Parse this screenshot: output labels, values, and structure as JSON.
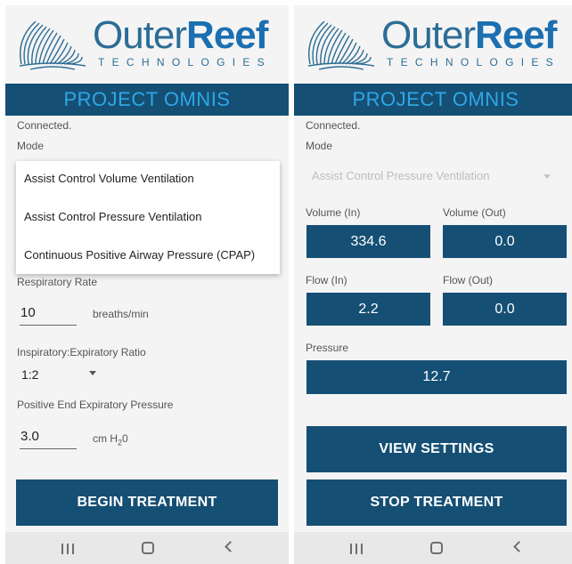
{
  "brand": {
    "outer": "Outer",
    "reef": "Reef",
    "sub": "TECHNOLOGIES"
  },
  "title": "PROJECT OMNIS",
  "colors": {
    "primary_dark": "#154f74",
    "title_text": "#2fa7e6",
    "logo_blue": "#2c6d96"
  },
  "left": {
    "status": "Connected.",
    "mode_label": "Mode",
    "mode_options": [
      "Assist Control Volume Ventilation",
      "Assist Control Pressure Ventilation",
      "Continuous Positive Airway Pressure (CPAP)"
    ],
    "respiratory_rate_label": "Respiratory Rate",
    "respiratory_rate_value": "10",
    "respiratory_rate_unit": "breaths/min",
    "ie_ratio_label": "Inspiratory:Expiratory Ratio",
    "ie_ratio_value": "1:2",
    "peep_label": "Positive End Expiratory Pressure",
    "peep_value": "3.0",
    "peep_unit_prefix": "cm H",
    "peep_unit_sub": "2",
    "peep_unit_suffix": "0",
    "begin_button": "BEGIN TREATMENT"
  },
  "right": {
    "status": "Connected.",
    "mode_label": "Mode",
    "mode_value": "Assist Control Pressure Ventilation",
    "volume_in_label": "Volume (In)",
    "volume_in_value": "334.6",
    "volume_out_label": "Volume (Out)",
    "volume_out_value": "0.0",
    "flow_in_label": "Flow (In)",
    "flow_in_value": "2.2",
    "flow_out_label": "Flow (Out)",
    "flow_out_value": "0.0",
    "pressure_label": "Pressure",
    "pressure_value": "12.7",
    "view_settings_button": "VIEW SETTINGS",
    "stop_button": "STOP TREATMENT"
  },
  "navbar": {
    "icons": [
      "recent-apps-icon",
      "home-icon",
      "back-icon"
    ]
  }
}
